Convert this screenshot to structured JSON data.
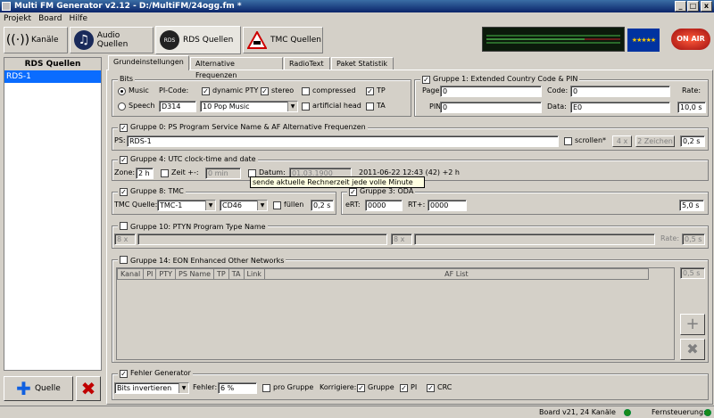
{
  "window": {
    "title": "Multi FM Generator v2.12 - D:/MultiFM/24ogg.fm *",
    "minimize": "_",
    "maximize": "□",
    "close": "x"
  },
  "menu": {
    "items": [
      "Projekt",
      "Board",
      "Hilfe"
    ]
  },
  "source_tabs": [
    {
      "label": "Kanäle",
      "icon": "antenna-icon"
    },
    {
      "label": "Audio Quellen",
      "icon": "music-note-icon"
    },
    {
      "label": "RDS Quellen",
      "icon": "rds-icon"
    },
    {
      "label": "TMC Quellen",
      "icon": "traffic-warning-icon"
    }
  ],
  "branding": {
    "eu_label": "★★★★★",
    "on_air": "ON AIR",
    "rds_badge": "RDS"
  },
  "left": {
    "header": "RDS Quellen",
    "items": [
      "RDS-1"
    ],
    "add_label": "Quelle",
    "delete_label": "✖"
  },
  "sub_tabs": [
    "Grundeinstellungen",
    "Alternative Frequenzen",
    "RadioText",
    "Paket Statistik"
  ],
  "bits": {
    "title": "Bits",
    "music": "Music",
    "speech": "Speech",
    "pi_label": "PI-Code:",
    "pi_value": "D314",
    "dynamic_pty": "dynamic PTY",
    "stereo": "stereo",
    "compressed": "compressed",
    "tp": "TP",
    "pty_value": "10 Pop Music",
    "artificial_head": "artificial head",
    "ta": "TA"
  },
  "g1": {
    "title": "Gruppe 1: Extended Country Code & PIN",
    "pager_label": "Pager:",
    "pager_value": "0",
    "code_label": "Code:",
    "code_value": "0",
    "rate_label": "Rate:",
    "rate_value": "10,0 s",
    "pin_label": "PIN:",
    "pin_value": "0",
    "data_label": "Data:",
    "data_value": "E0"
  },
  "g0": {
    "title": "Gruppe 0: PS Program Service Name & AF Alternative Frequenzen",
    "ps_label": "PS:",
    "ps_value": "RDS-1",
    "scroll_label": "scrollen*",
    "scroll_x": "4 x",
    "chars": "2 Zeichen",
    "rate": "0,2 s"
  },
  "g4": {
    "title": "Gruppe 4: UTC clock-time and date",
    "zone_label": "Zone:",
    "zone_value": "2 h",
    "zeit_label": "Zeit +-:",
    "zeit_value": "0 min",
    "datum_label": "Datum:",
    "datum_value": "01.03.1900",
    "timestamp": "2011-06-22 12:43 (42) +2 h",
    "tooltip": "sende aktuelle Rechnerzeit jede volle Minute"
  },
  "g8": {
    "title": "Gruppe 8: TMC",
    "quelle_label": "TMC Quelle:",
    "quelle_value": "TMC-1",
    "cd_value": "CD46",
    "fuellen": "füllen",
    "rate": "0,2 s"
  },
  "g3": {
    "title": "Gruppe 3: ODA",
    "ert_label": "eRT:",
    "ert_value": "0000",
    "rtplus_label": "RT+:",
    "rtplus_value": "0000",
    "rate": "5,0 s"
  },
  "g10": {
    "title": "Gruppe 10: PTYN Program Type Name",
    "x1": "8 x",
    "x2": "8 x",
    "rate_label": "Rate:",
    "rate": "0,5 s"
  },
  "g14": {
    "title": "Gruppe 14: EON Enhanced Other Networks",
    "columns": [
      "Kanal",
      "PI",
      "PTY",
      "PS Name",
      "TP",
      "TA",
      "Link",
      "AF List"
    ],
    "rate": "0,5 s",
    "add_icon": "+",
    "del_icon": "✖"
  },
  "fehler": {
    "title": "Fehler Generator",
    "mode_value": "Bits invertieren",
    "fehler_label": "Fehler:",
    "fehler_value": "6 %",
    "pro_gruppe": "pro Gruppe",
    "korrigiere": "Korrigiere:",
    "gruppe": "Gruppe",
    "pi": "PI",
    "crc": "CRC"
  },
  "status": {
    "board": "Board v21, 24 Kanäle",
    "remote": "Fernsteuerung:"
  },
  "colors": {
    "selection": "#0a6cff",
    "title_bar": "#0a246a",
    "tooltip": "#ffffe1"
  }
}
